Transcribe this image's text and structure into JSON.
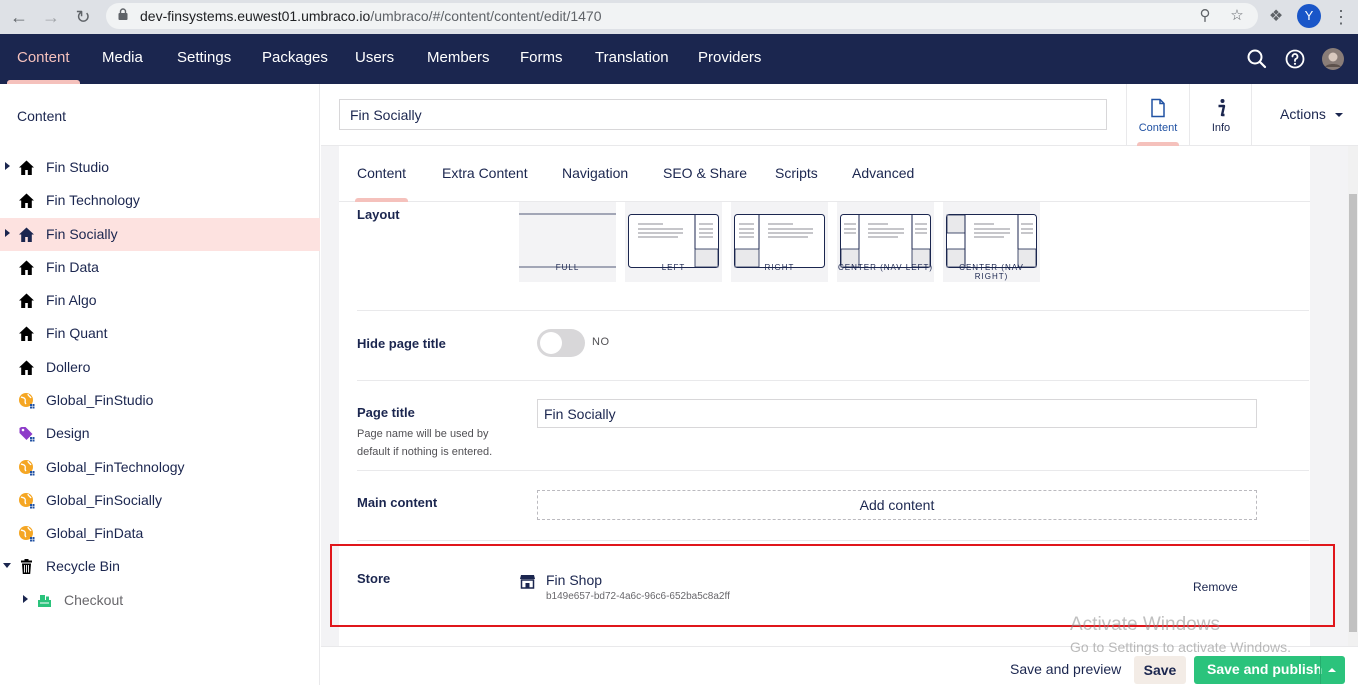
{
  "browser": {
    "url_host": "dev-finsystems.euwest01.umbraco.io",
    "url_path": "/umbraco/#/content/content/edit/1470",
    "profile_initial": "Y"
  },
  "sections": [
    {
      "label": "Content",
      "active": true
    },
    {
      "label": "Media"
    },
    {
      "label": "Settings"
    },
    {
      "label": "Packages"
    },
    {
      "label": "Users"
    },
    {
      "label": "Members"
    },
    {
      "label": "Forms"
    },
    {
      "label": "Translation"
    },
    {
      "label": "Providers"
    }
  ],
  "tree": {
    "title": "Content",
    "items": [
      {
        "label": "Fin Studio",
        "icon": "home-icon",
        "caret": "right"
      },
      {
        "label": "Fin Technology",
        "icon": "home-icon"
      },
      {
        "label": "Fin Socially",
        "icon": "home-icon",
        "caret": "right",
        "selected": true
      },
      {
        "label": "Fin Data",
        "icon": "home-icon"
      },
      {
        "label": "Fin Algo",
        "icon": "home-icon"
      },
      {
        "label": "Fin Quant",
        "icon": "home-icon"
      },
      {
        "label": "Dollero",
        "icon": "home-icon"
      },
      {
        "label": "Global_FinStudio",
        "icon": "globe-icon"
      },
      {
        "label": "Design",
        "icon": "tag-icon"
      },
      {
        "label": "Global_FinTechnology",
        "icon": "globe-icon"
      },
      {
        "label": "Global_FinSocially",
        "icon": "globe-icon"
      },
      {
        "label": "Global_FinData",
        "icon": "globe-icon"
      },
      {
        "label": "Recycle Bin",
        "icon": "trash-icon",
        "caret": "down"
      },
      {
        "label": "Checkout",
        "icon": "checkout-icon",
        "caret": "right",
        "child": true
      }
    ]
  },
  "editor": {
    "node_name": "Fin Socially",
    "apps": [
      {
        "label": "Content",
        "icon": "document-icon",
        "active": true
      },
      {
        "label": "Info",
        "icon": "info-icon"
      }
    ],
    "actions_label": "Actions",
    "tabs": [
      "Content",
      "Extra Content",
      "Navigation",
      "SEO & Share",
      "Scripts",
      "Advanced"
    ],
    "active_tab": "Content",
    "layout": {
      "label": "Layout",
      "options": [
        "FULL",
        "LEFT",
        "RIGHT",
        "CENTER (NAV LEFT)",
        "CENTER (NAV RIGHT)"
      ]
    },
    "hide_page_title": {
      "label": "Hide page title",
      "state_text": "NO"
    },
    "page_title": {
      "label": "Page title",
      "description": "Page name will be used by default if nothing is entered.",
      "value": "Fin Socially"
    },
    "main_content": {
      "label": "Main content",
      "button": "Add content"
    },
    "store": {
      "label": "Store",
      "item_name": "Fin Shop",
      "item_id": "b149e657-bd72-4a6c-96c6-652ba5c8a2ff",
      "remove_label": "Remove"
    }
  },
  "footer": {
    "save_preview": "Save and preview",
    "save": "Save",
    "save_publish": "Save and publish"
  },
  "watermark": {
    "line1": "Activate Windows",
    "line2": "Go to Settings to activate Windows."
  },
  "colors": {
    "header_bg": "#1b264f",
    "accent_pink": "#f5c1bc",
    "publish_green": "#2bc37c",
    "highlight_red": "#e0161b"
  }
}
